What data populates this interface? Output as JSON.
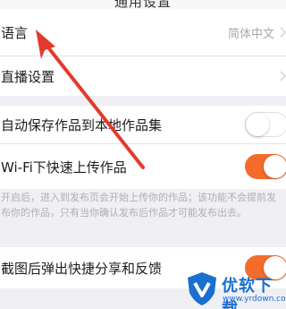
{
  "header": {
    "title": "通用设置"
  },
  "settings": {
    "language": {
      "label": "语言",
      "value": "简体中文"
    },
    "live": {
      "label": "直播设置"
    },
    "autosave": {
      "label": "自动保存作品到本地作品集",
      "enabled": false
    },
    "wifi_upload": {
      "label": "Wi-Fi下快速上传作品",
      "enabled": true,
      "note": "开启后，进入到发布页会开始上传你的作品；该功能不会提前发布你的作品，只有当你确认发布后作品才可能发布出去。"
    },
    "screenshot_share": {
      "label": "截图后弹出快捷分享和反馈",
      "enabled": true
    }
  },
  "colors": {
    "accent": "#f36c2c",
    "annotation_arrow": "#e23a2c",
    "watermark": "#1a6fd1"
  },
  "watermark": {
    "brand": "优软下载",
    "url": "www.yrdown.com"
  }
}
